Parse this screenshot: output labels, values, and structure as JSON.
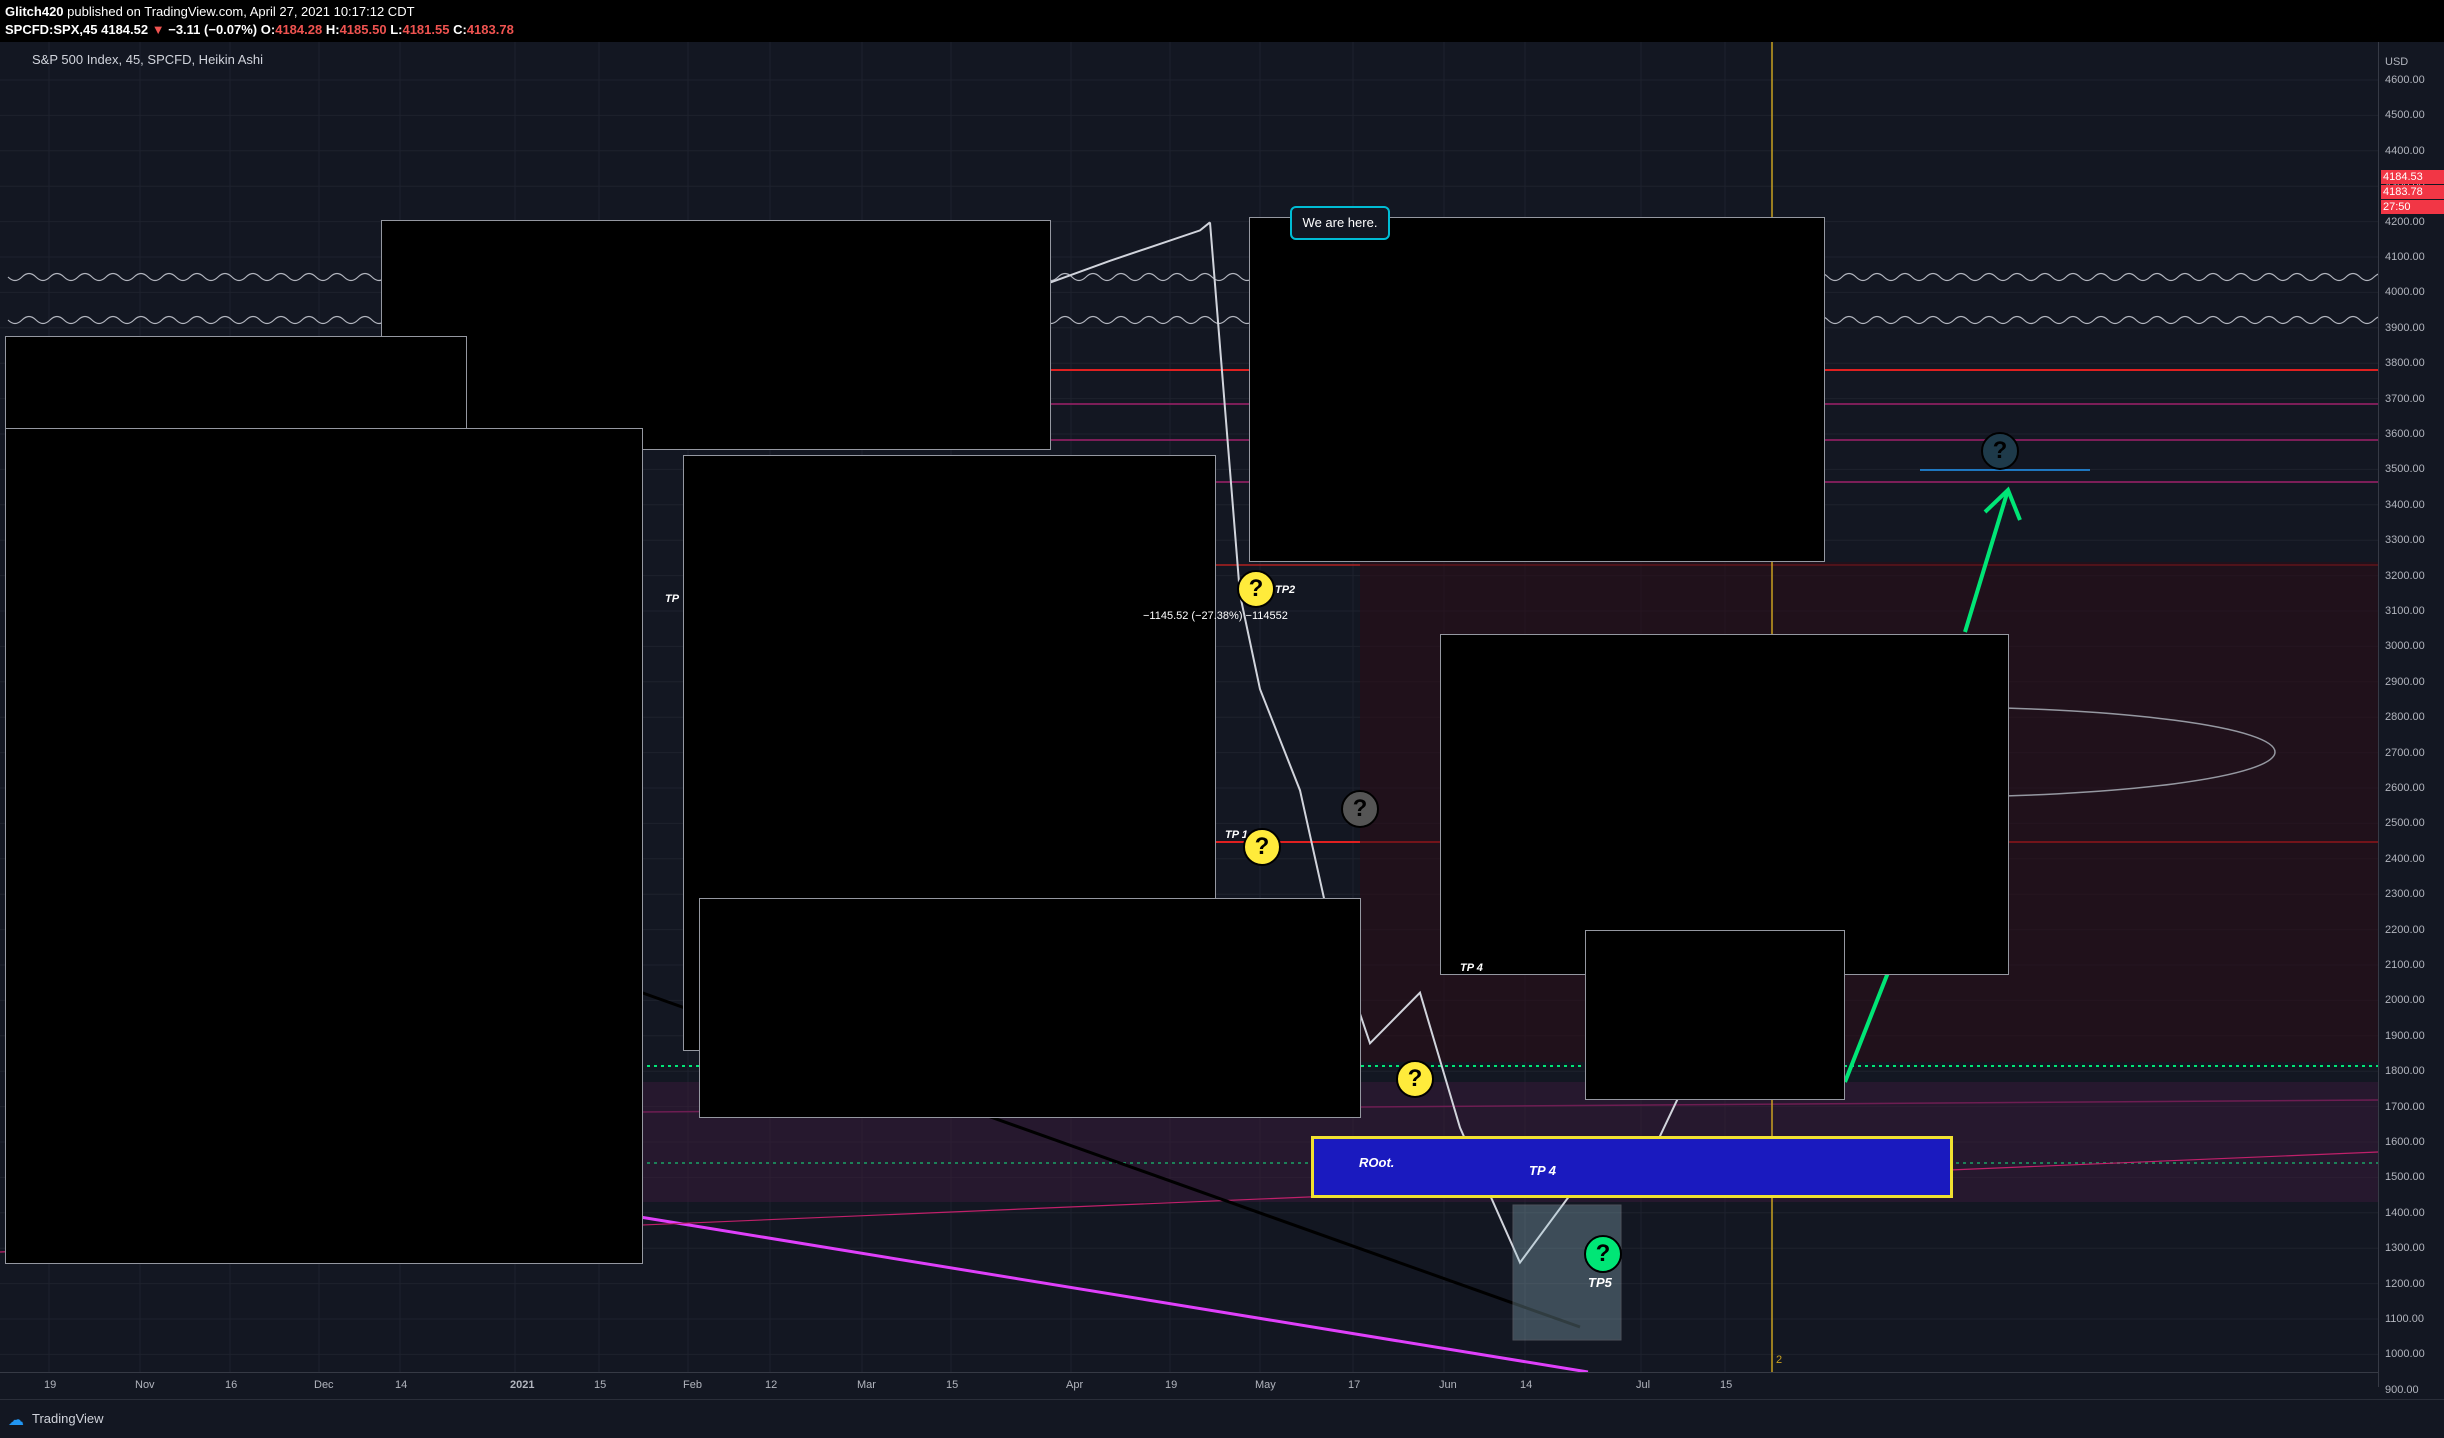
{
  "header": {
    "publisher": "Glitch420",
    "published_text": "published on TradingView.com, April 27, 2021 10:17:12 CDT",
    "symbol": "SPCFD:SPX,",
    "symbol_suffix": "45",
    "last": "4184.52",
    "change": "−3.11 (−0.07%)",
    "o_label": "O:",
    "o": "4184.28",
    "h_label": "H:",
    "h": "4185.50",
    "l_label": "L:",
    "l": "4181.55",
    "c_label": "C:",
    "c": "4183.78"
  },
  "legend": {
    "title": "S&P 500 Index, 45, SPCFD, Heikin Ashi"
  },
  "price_axis": {
    "currency": "USD",
    "ticks": [
      "4600.00",
      "4500.00",
      "4400.00",
      "4300.00",
      "4200.00",
      "4100.00",
      "4000.00",
      "3900.00",
      "3800.00",
      "3700.00",
      "3600.00",
      "3500.00",
      "3400.00",
      "3300.00",
      "3200.00",
      "3100.00",
      "3000.00",
      "2900.00",
      "2800.00",
      "2700.00",
      "2600.00",
      "2500.00",
      "2400.00",
      "2300.00",
      "2200.00",
      "2100.00",
      "2000.00",
      "1900.00",
      "1800.00",
      "1700.00",
      "1600.00",
      "1500.00",
      "1400.00",
      "1300.00",
      "1200.00",
      "1100.00",
      "1000.00",
      "900.00"
    ],
    "price_label_1": "4184.53",
    "price_label_2": "4183.78",
    "price_label_3": "27:50"
  },
  "time_axis": {
    "ticks": [
      "19",
      "Nov",
      "16",
      "Dec",
      "14",
      "2021",
      "15",
      "Feb",
      "12",
      "Mar",
      "15",
      "Apr",
      "19",
      "May",
      "17",
      "Jun",
      "14",
      "Jul",
      "15"
    ]
  },
  "annotations": {
    "callout": "We are here.",
    "tp2": "TP2",
    "tp1": "TP 1",
    "tp4_top": "TP 4",
    "tp4_box": "TP 4",
    "root": "ROot.",
    "tp5": "TP5",
    "tp_left": "TP",
    "measure": "−1145.52 (−27.38%) −114552",
    "qmark": "?",
    "vertical_marker": "2"
  },
  "footer": {
    "brand": "TradingView"
  },
  "colors": {
    "background": "#131722",
    "price_line_red": "#f23645",
    "green": "#00e676",
    "magenta": "#e040fb",
    "yellow": "#ffeb3b",
    "blue_box": "#1a1abf",
    "accent_cyan": "#00bcd4",
    "vertical_orange": "#c8a020"
  },
  "chart_data": {
    "type": "line",
    "title": "S&P 500 Index, 45, SPCFD, Heikin Ashi",
    "xlabel": "",
    "ylabel": "",
    "ylim": [
      900,
      4600
    ],
    "series": [
      {
        "x": [
          "Apr 1",
          "Apr 8",
          "Apr 15",
          "Apr 22",
          "Apr 27"
        ],
        "values": [
          4000,
          4070,
          4120,
          4160,
          4184
        ]
      },
      {
        "x": [
          "Apr 27",
          "May 1",
          "May 7",
          "May 14",
          "May 20",
          "May 27",
          "Jun 3",
          "Jun 10",
          "Jun 15",
          "Jun 20",
          "Jun 25",
          "Jul 1",
          "Jul 6",
          "Jul 12",
          "Jul 18",
          "Jul 24"
        ],
        "values": [
          4184,
          3080,
          2800,
          2500,
          2100,
          1750,
          1900,
          1500,
          1100,
          1300,
          1400,
          1350,
          1600,
          1700,
          1800,
          2050
        ]
      }
    ]
  }
}
